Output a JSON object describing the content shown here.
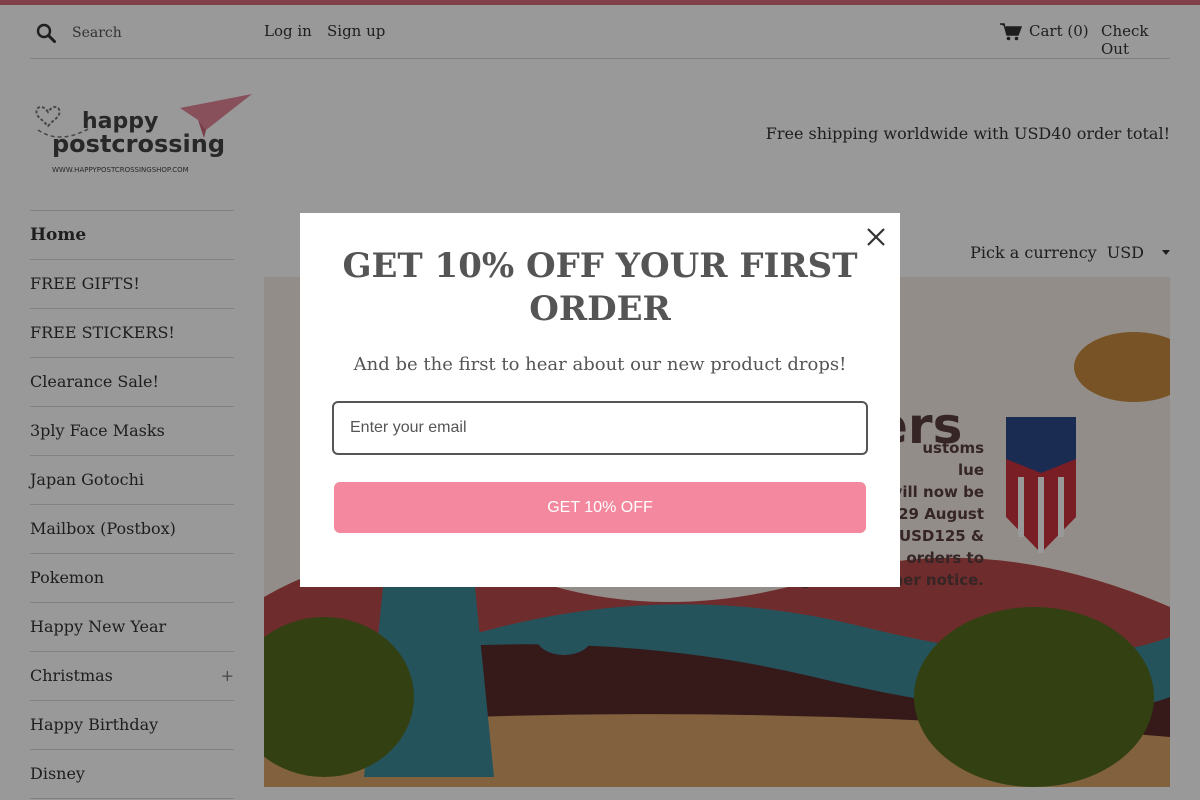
{
  "header": {
    "search_placeholder": "Search",
    "login_label": "Log in",
    "signup_label": "Sign up",
    "cart_label": "Cart (0)",
    "checkout_label": "Check Out"
  },
  "logo": {
    "line1": "happy",
    "line2": "postcrossing",
    "url": "WWW.HAPPYPOSTCROSSINGSHOP.COM"
  },
  "shipping_note": "Free shipping worldwide with USD40 order total!",
  "sidebar": {
    "items": [
      {
        "label": "Home"
      },
      {
        "label": "FREE GIFTS!"
      },
      {
        "label": "FREE STICKERS!"
      },
      {
        "label": "Clearance Sale!"
      },
      {
        "label": "3ply Face Masks"
      },
      {
        "label": "Japan Gotochi"
      },
      {
        "label": "Mailbox (Postbox)"
      },
      {
        "label": "Pokemon"
      },
      {
        "label": "Happy New Year"
      },
      {
        "label": "Christmas",
        "expand": "+"
      },
      {
        "label": "Happy Birthday"
      },
      {
        "label": "Disney"
      }
    ]
  },
  "currency": {
    "label": "Pick a currency",
    "value": "USD"
  },
  "banner": {
    "heading": "ers",
    "text": "ustoms\nlue\nvill now be\n29 August\no USD125 &\n orders to\nserver the time being until further notice."
  },
  "modal": {
    "title": "GET 10% OFF YOUR FIRST ORDER",
    "subtitle": "And be the first to hear about our new product drops!",
    "email_placeholder": "Enter your email",
    "button_label": "GET 10% OFF"
  },
  "colors": {
    "accent": "#d96b7e",
    "cta": "#f3889e"
  }
}
